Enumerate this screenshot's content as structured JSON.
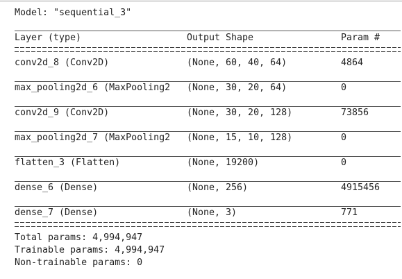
{
  "model_label": "Model: \"sequential_3\"",
  "headers": {
    "layer": "Layer (type)",
    "output": "Output Shape",
    "params": "Param #"
  },
  "layers": [
    {
      "name": "conv2d_8 (Conv2D)",
      "shape": "(None, 60, 40, 64)",
      "params": "4864"
    },
    {
      "name": "max_pooling2d_6 (MaxPooling2",
      "shape": "(None, 30, 20, 64)",
      "params": "0"
    },
    {
      "name": "conv2d_9 (Conv2D)",
      "shape": "(None, 30, 20, 128)",
      "params": "73856"
    },
    {
      "name": "max_pooling2d_7 (MaxPooling2",
      "shape": "(None, 15, 10, 128)",
      "params": "0"
    },
    {
      "name": "flatten_3 (Flatten)",
      "shape": "(None, 19200)",
      "params": "0"
    },
    {
      "name": "dense_6 (Dense)",
      "shape": "(None, 256)",
      "params": "4915456"
    },
    {
      "name": "dense_7 (Dense)",
      "shape": "(None, 3)",
      "params": "771"
    }
  ],
  "totals": {
    "total": "Total params: 4,994,947",
    "trainable": "Trainable params: 4,994,947",
    "non_trainable": "Non-trainable params: 0"
  }
}
